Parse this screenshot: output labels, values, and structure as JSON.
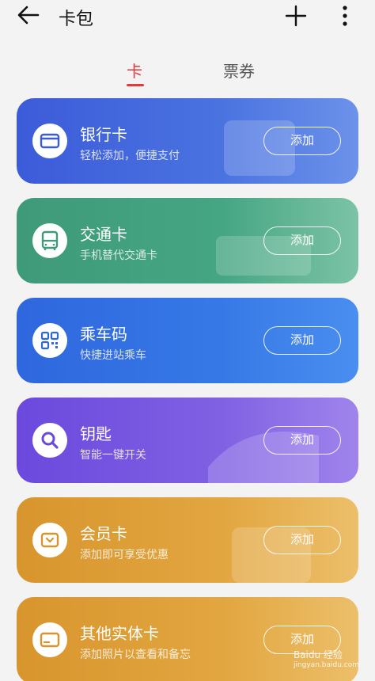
{
  "header": {
    "title": "卡包"
  },
  "tabs": [
    {
      "label": "卡",
      "active": true
    },
    {
      "label": "票券",
      "active": false
    }
  ],
  "cards": [
    {
      "name": "银行卡",
      "subtitle": "轻松添加，便捷支付",
      "button": "添加",
      "icon": "bank-card-icon",
      "color": "#3c5bd9"
    },
    {
      "name": "交通卡",
      "subtitle": "手机替代交通卡",
      "button": "添加",
      "icon": "bus-icon",
      "color": "#3f9a79"
    },
    {
      "name": "乘车码",
      "subtitle": "快捷进站乘车",
      "button": "添加",
      "icon": "qr-code-icon",
      "color": "#2f67de"
    },
    {
      "name": "钥匙",
      "subtitle": "智能一键开关",
      "button": "添加",
      "icon": "key-icon",
      "color": "#6b49dd"
    },
    {
      "name": "会员卡",
      "subtitle": "添加即可享受优惠",
      "button": "添加",
      "icon": "member-card-icon",
      "color": "#d8952d"
    },
    {
      "name": "其他实体卡",
      "subtitle": "添加照片以查看和备忘",
      "button": "添加",
      "icon": "card-icon",
      "color": "#d8952d"
    }
  ],
  "watermark": {
    "text": "Baidu 经验",
    "sub": "jingyan.baidu.com"
  }
}
